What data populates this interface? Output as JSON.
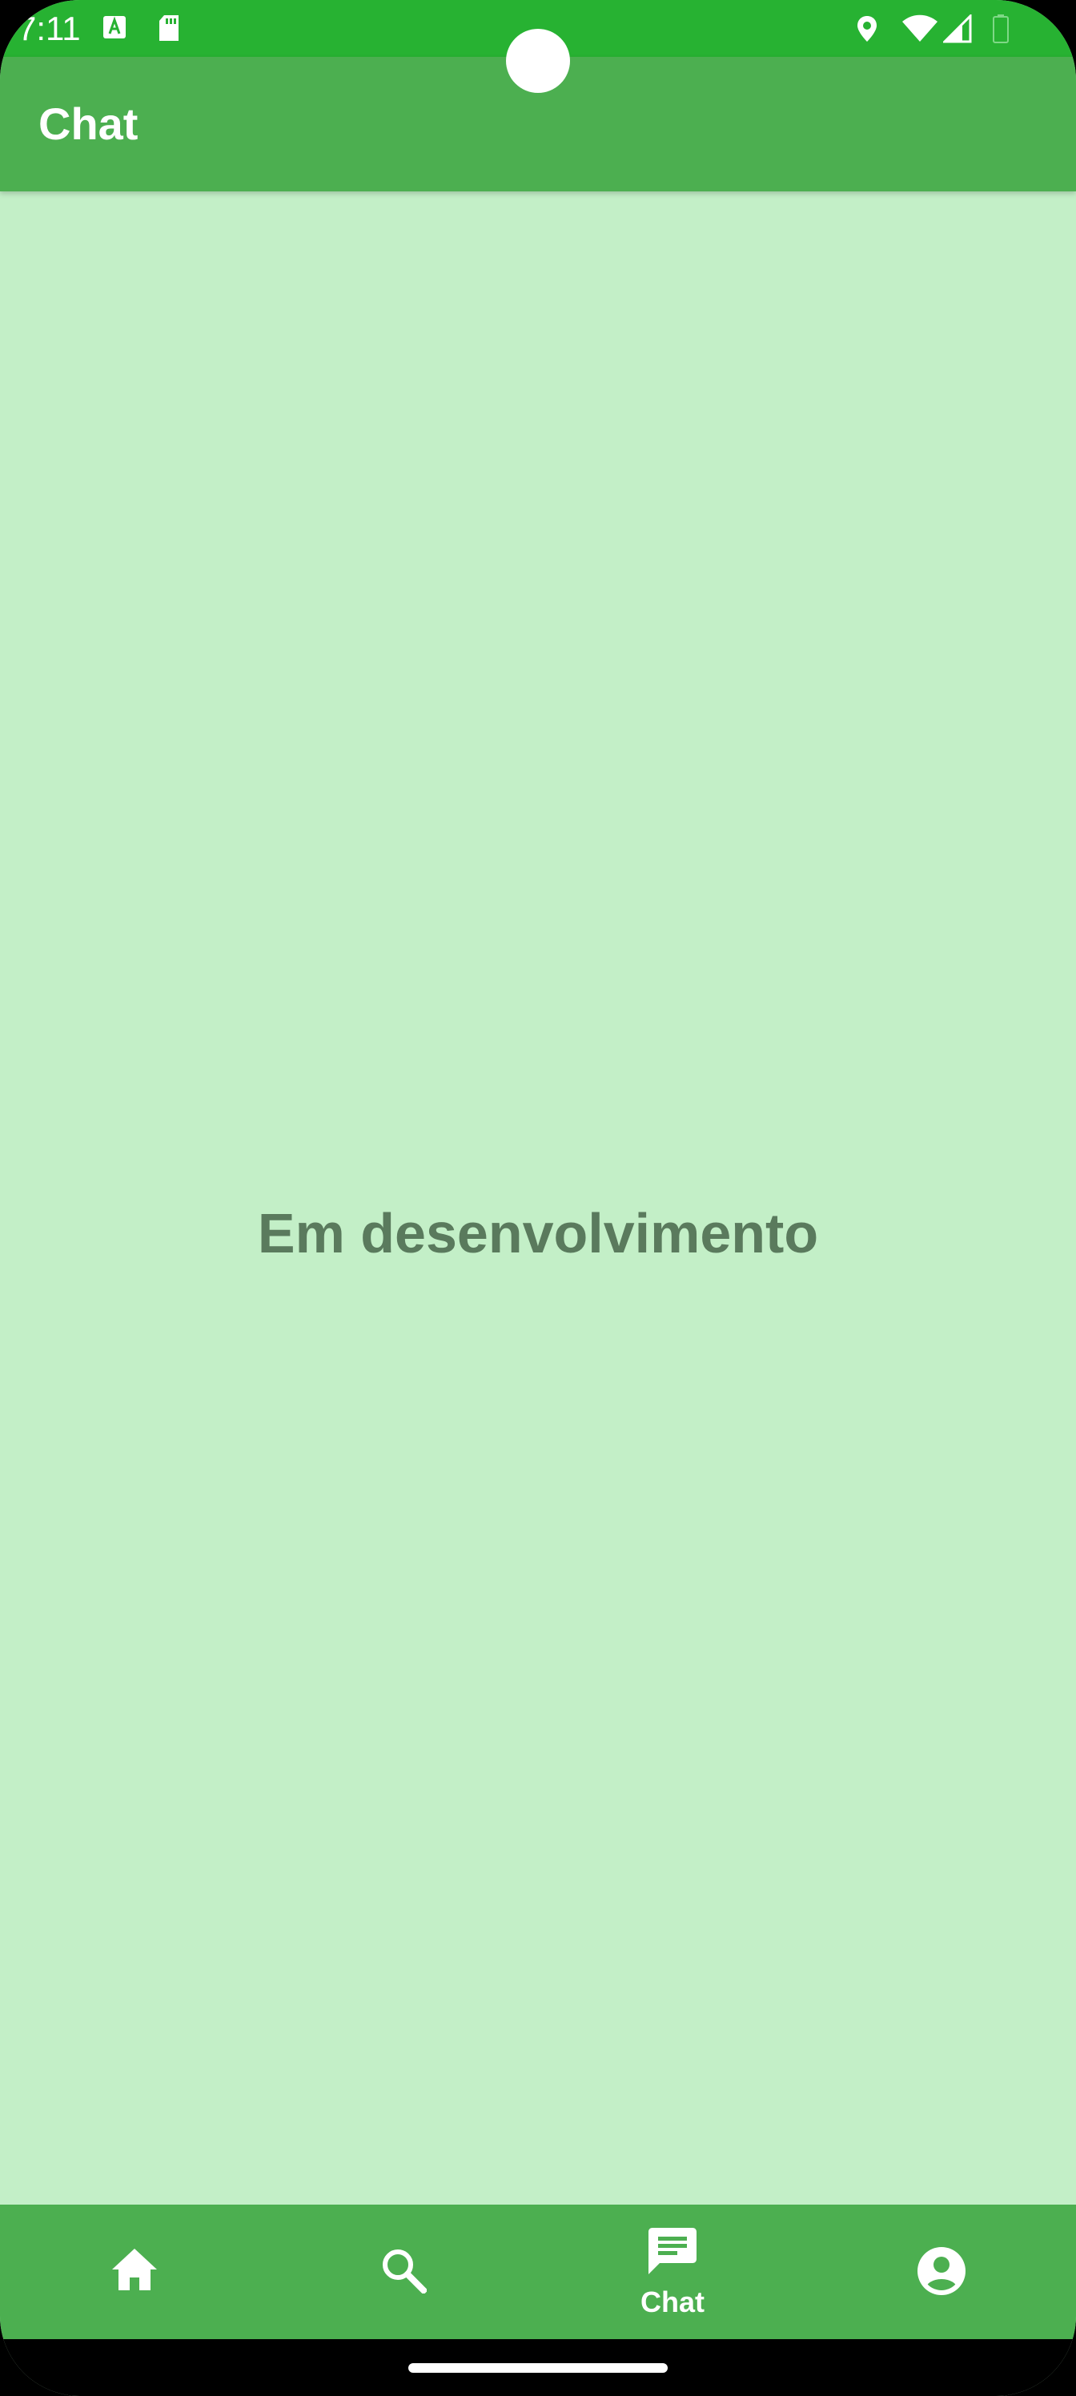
{
  "status_bar": {
    "time": "7:11",
    "icons": [
      "keyboard-a-icon",
      "sd-card-icon",
      "location-icon",
      "wifi-icon",
      "signal-icon",
      "battery-icon"
    ]
  },
  "app_bar": {
    "title": "Chat"
  },
  "main": {
    "placeholder": "Em desenvolvimento"
  },
  "bottom_nav": {
    "items": [
      {
        "icon": "home-icon",
        "label": ""
      },
      {
        "icon": "search-icon",
        "label": ""
      },
      {
        "icon": "chat-icon",
        "label": "Chat",
        "selected": true
      },
      {
        "icon": "account-circle-icon",
        "label": ""
      }
    ]
  },
  "colors": {
    "status_bar": "#27b232",
    "primary": "#4caf50",
    "background": "#c3efc7",
    "placeholder_text": "#5a7a5d"
  }
}
